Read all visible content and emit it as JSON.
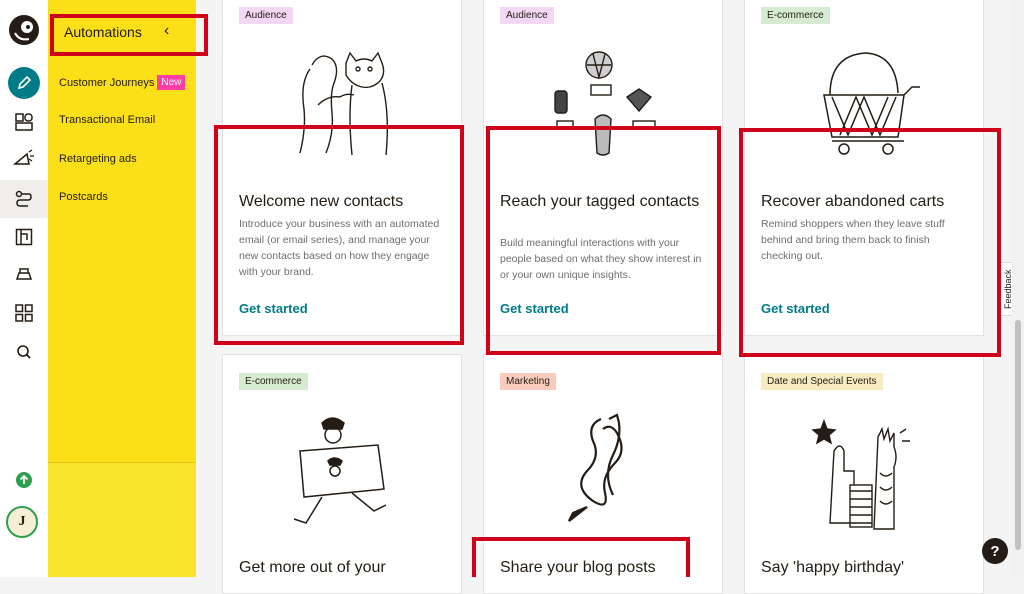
{
  "sidebar": {
    "header": "Automations",
    "collapse_glyph": "‹",
    "items": [
      {
        "label": "Customer Journeys",
        "badge": "New"
      },
      {
        "label": "Transactional Email"
      },
      {
        "label": "Retargeting ads"
      },
      {
        "label": "Postcards"
      }
    ]
  },
  "rail": {
    "avatar_initial": "J",
    "icons": [
      "mailchimp-logo-icon",
      "pencil-create-icon",
      "audience-icon",
      "campaigns-megaphone-icon",
      "automations-icon",
      "website-icon",
      "content-studio-icon",
      "integrations-grid-icon",
      "search-icon",
      "upgrade-arrow-icon"
    ]
  },
  "cards": [
    {
      "tag": "Audience",
      "tag_color": "#f4d7f4",
      "title": "Welcome new contacts",
      "desc": "Introduce your business with an automated email (or email series), and manage your new contacts based on how they engage with your brand.",
      "cta": "Get started"
    },
    {
      "tag": "Audience",
      "tag_color": "#f4d7f4",
      "title": "Reach your tagged contacts",
      "desc": "Build meaningful interactions with your people based on what they show interest in or your own unique insights.",
      "cta": "Get started"
    },
    {
      "tag": "E-commerce",
      "tag_color": "#d6ecd2",
      "title": "Recover abandoned carts",
      "desc": "Remind shoppers when they leave stuff behind and bring them back to finish checking out.",
      "cta": "Get started"
    },
    {
      "tag": "E-commerce",
      "tag_color": "#d6ecd2",
      "title": "Get more out of your"
    },
    {
      "tag": "Marketing",
      "tag_color": "#f8ccbc",
      "title": "Share your blog posts"
    },
    {
      "tag": "Date and Special Events",
      "tag_color": "#f7ecc1",
      "title": "Say 'happy birthday'"
    }
  ],
  "feedback_label": "Feedback",
  "help_label": "?",
  "colors": {
    "sidebar": "#fbe019",
    "accent": "#007c89",
    "highlight": "#d0021b",
    "new_badge": "#ff3ea5"
  }
}
